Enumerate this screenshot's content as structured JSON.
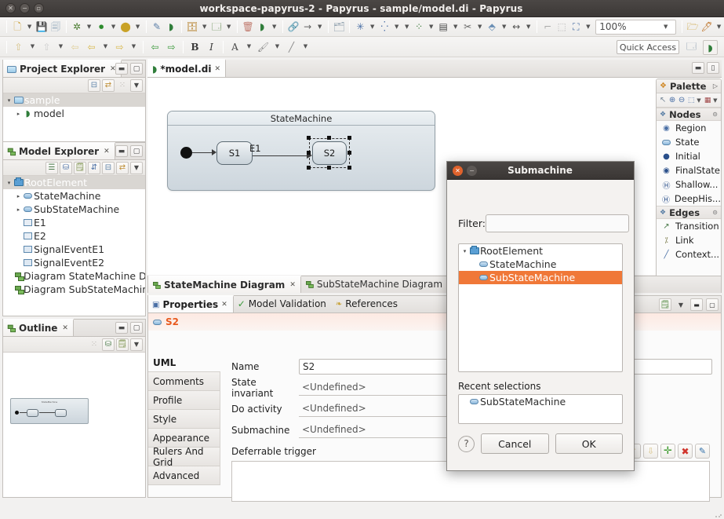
{
  "window": {
    "title": "workspace-papyrus-2 - Papyrus - sample/model.di - Papyrus",
    "controls": [
      "close",
      "minimize",
      "maximize"
    ]
  },
  "toolbar": {
    "row1": [
      {
        "name": "new-wizard",
        "glyph": "🗋",
        "menu": true
      },
      {
        "name": "save",
        "glyph": "💾"
      },
      {
        "name": "save-all",
        "glyph": "🗐"
      },
      {
        "name": "debug",
        "glyph": "🐞",
        "menu": true
      },
      {
        "name": "run",
        "glyph": "▶",
        "menu": true
      },
      {
        "name": "profile",
        "glyph": "🔍",
        "menu": true
      },
      {
        "name": "new-java-class",
        "glyph": "✎"
      },
      {
        "name": "papyrus-perspective",
        "glyph": "◗"
      },
      {
        "name": "import-model",
        "glyph": "📤",
        "menu": true
      },
      {
        "name": "new-diagram",
        "glyph": "🖼",
        "menu": true
      },
      {
        "name": "delete-element",
        "glyph": "🗑"
      },
      {
        "name": "papyrus-model",
        "glyph": "◗",
        "menu": true
      },
      {
        "name": "link-editor",
        "glyph": "🔗"
      },
      {
        "name": "forward-arrow",
        "glyph": "→",
        "menu": true
      },
      {
        "name": "open-resource",
        "glyph": "🗂"
      },
      {
        "name": "layout-grid",
        "glyph": "✳",
        "menu": true
      },
      {
        "name": "distribute",
        "glyph": "⫶",
        "menu": true
      },
      {
        "name": "align",
        "glyph": "⊞",
        "menu": true
      },
      {
        "name": "fill-color",
        "glyph": "▤",
        "menu": true
      },
      {
        "name": "line-style",
        "glyph": "✂",
        "menu": true
      },
      {
        "name": "flip",
        "glyph": "⬘",
        "menu": true
      },
      {
        "name": "size-width",
        "glyph": "↔",
        "menu": true
      },
      {
        "name": "snap-back",
        "glyph": "⌐"
      },
      {
        "name": "select-all",
        "glyph": "⬚"
      },
      {
        "name": "zoom-fit",
        "glyph": "⛶",
        "menu": true
      }
    ],
    "zoom_value": "100%",
    "row1_tail": [
      {
        "name": "open-perspective",
        "glyph": "🗁"
      },
      {
        "name": "pin-editor",
        "glyph": "🖊",
        "menu": true
      }
    ],
    "row2": [
      {
        "name": "arrow-up-small",
        "glyph": "⇧",
        "menu": true
      },
      {
        "name": "arrow-up-gray",
        "glyph": "⇧",
        "menu": true
      },
      {
        "name": "back-pale",
        "glyph": "⇦"
      },
      {
        "name": "back-yellow",
        "glyph": "⇦",
        "menu": true
      },
      {
        "name": "forward-yellow",
        "glyph": "⇨",
        "menu": true
      },
      {
        "name": "back-green",
        "glyph": "⇦"
      },
      {
        "name": "forward-green",
        "glyph": "⇨"
      },
      {
        "name": "bold",
        "glyph": "B"
      },
      {
        "name": "italic",
        "glyph": "I"
      },
      {
        "name": "font-color",
        "glyph": "A",
        "menu": true
      },
      {
        "name": "fill-color-2",
        "glyph": "🖌",
        "menu": true
      },
      {
        "name": "line-color",
        "glyph": "╱",
        "menu": true
      }
    ],
    "quick_access": "Quick Access",
    "perspective_buttons": [
      {
        "name": "open-perspective-icon",
        "glyph": "🗔"
      },
      {
        "name": "papyrus-perspective-icon",
        "glyph": "◗"
      }
    ]
  },
  "project_explorer": {
    "title": "Project Explorer",
    "view_buttons": [
      {
        "name": "collapse-all-icon",
        "glyph": "⊟"
      },
      {
        "name": "link-with-editor-icon",
        "glyph": "⇄"
      },
      {
        "name": "focus-icon",
        "glyph": "⁙"
      },
      {
        "name": "view-menu-icon",
        "glyph": "▾"
      }
    ],
    "items": [
      {
        "label": "sample",
        "icon": "project-folder-icon",
        "twisty": "▾",
        "indent": 0,
        "selected": true
      },
      {
        "label": "model",
        "icon": "papyrus-model-icon",
        "twisty": "▸",
        "indent": 1,
        "selected": false
      }
    ]
  },
  "model_explorer": {
    "title": "Model Explorer",
    "view_buttons": [
      {
        "name": "list-view-icon",
        "glyph": "☰"
      },
      {
        "name": "tree-view-icon",
        "glyph": "⛁"
      },
      {
        "name": "new-child-icon",
        "glyph": "🗒"
      },
      {
        "name": "sort-icon",
        "glyph": "⇅"
      },
      {
        "name": "collapse-all-icon",
        "glyph": "⊟"
      },
      {
        "name": "link-with-editor-icon",
        "glyph": "⇄"
      },
      {
        "name": "view-menu-icon",
        "glyph": "▾"
      }
    ],
    "items": [
      {
        "label": "RootElement",
        "icon": "package-icon",
        "twisty": "▾",
        "indent": 0,
        "selected": true
      },
      {
        "label": "StateMachine",
        "icon": "state-icon",
        "twisty": "▸",
        "indent": 1,
        "selected": false
      },
      {
        "label": "SubStateMachine",
        "icon": "state-icon",
        "twisty": "▸",
        "indent": 1,
        "selected": false
      },
      {
        "label": "E1",
        "icon": "signal-icon",
        "twisty": "",
        "indent": 1,
        "selected": false
      },
      {
        "label": "E2",
        "icon": "signal-icon",
        "twisty": "",
        "indent": 1,
        "selected": false
      },
      {
        "label": "SignalEventE1",
        "icon": "signal-event-icon",
        "twisty": "",
        "indent": 1,
        "selected": false
      },
      {
        "label": "SignalEventE2",
        "icon": "signal-event-icon",
        "twisty": "",
        "indent": 1,
        "selected": false
      },
      {
        "label": "Diagram StateMachine Diagr",
        "icon": "diagram-icon",
        "twisty": "",
        "indent": 1,
        "selected": false
      },
      {
        "label": "Diagram SubStateMachine D",
        "icon": "diagram-icon",
        "twisty": "",
        "indent": 1,
        "selected": false
      }
    ]
  },
  "outline": {
    "title": "Outline",
    "view_buttons": [
      {
        "name": "focus-icon",
        "glyph": "⁙"
      },
      {
        "name": "outline-tree-icon",
        "glyph": "⛁"
      },
      {
        "name": "outline-thumbnail-icon",
        "glyph": "🗒"
      },
      {
        "name": "view-menu-icon",
        "glyph": "▾"
      }
    ],
    "thumbnail_label": "StateMachine"
  },
  "editor": {
    "tab_label": "*model.di",
    "tab_icon": "papyrus-icon",
    "diagram": {
      "frame_title": "StateMachine",
      "nodes": [
        {
          "name": "initial-node",
          "label": ""
        },
        {
          "name": "state-s1",
          "label": "S1"
        },
        {
          "name": "state-s2",
          "label": "S2",
          "selected": true
        }
      ],
      "transition_label": "E1"
    },
    "min_max_buttons": [
      {
        "name": "minimize-editor-icon",
        "glyph": "▭"
      },
      {
        "name": "maximize-editor-icon",
        "glyph": "▢"
      }
    ]
  },
  "palette": {
    "title": "Palette",
    "expand_glyph": "▷",
    "tools": [
      {
        "name": "select-tool-icon",
        "glyph": "↖"
      },
      {
        "name": "zoom-in-tool-icon",
        "glyph": "⊕"
      },
      {
        "name": "zoom-out-tool-icon",
        "glyph": "⊖"
      },
      {
        "name": "marquee-tool-icon",
        "glyph": "⬚",
        "menu": true
      },
      {
        "name": "format-tool-icon",
        "glyph": "▦",
        "menu": true
      }
    ],
    "groups": [
      {
        "label": "Nodes",
        "items": [
          {
            "label": "Region",
            "icon": "region-icon"
          },
          {
            "label": "State",
            "icon": "state-icon"
          },
          {
            "label": "Initial",
            "icon": "initial-icon"
          },
          {
            "label": "FinalState",
            "icon": "final-state-icon"
          },
          {
            "label": "Shallow...",
            "icon": "shallow-history-icon"
          },
          {
            "label": "DeepHis...",
            "icon": "deep-history-icon"
          }
        ]
      },
      {
        "label": "Edges",
        "items": [
          {
            "label": "Transition",
            "icon": "transition-icon"
          },
          {
            "label": "Link",
            "icon": "link-icon"
          },
          {
            "label": "Context...",
            "icon": "context-link-icon"
          }
        ]
      }
    ]
  },
  "diagram_tabs": [
    {
      "label": "StateMachine Diagram",
      "active": true,
      "closable": true
    },
    {
      "label": "SubStateMachine Diagram",
      "active": false,
      "closable": false
    }
  ],
  "properties": {
    "tabs": [
      {
        "label": "Properties",
        "active": true,
        "icon": "properties-icon",
        "closable": true
      },
      {
        "label": "Model Validation",
        "active": false,
        "icon": "check-icon"
      },
      {
        "label": "References",
        "active": false,
        "icon": "references-icon"
      }
    ],
    "view_buttons": [
      {
        "name": "pin-properties-icon",
        "glyph": "🗒"
      },
      {
        "name": "view-menu-icon",
        "glyph": "▾"
      },
      {
        "name": "minimize-icon",
        "glyph": "▭"
      },
      {
        "name": "maximize-icon",
        "glyph": "▢"
      }
    ],
    "selected_element": "S2",
    "selected_element_icon": "state-icon",
    "left_tabs": [
      {
        "label": "UML",
        "active": true
      },
      {
        "label": "Comments",
        "active": false
      },
      {
        "label": "Profile",
        "active": false
      },
      {
        "label": "Style",
        "active": false
      },
      {
        "label": "Appearance",
        "active": false
      },
      {
        "label": "Rulers And Grid",
        "active": false
      },
      {
        "label": "Advanced",
        "active": false
      }
    ],
    "fields": [
      {
        "label": "Name",
        "value": "S2",
        "type": "text",
        "buttons": []
      },
      {
        "label": "State invariant",
        "value": "<Undefined>",
        "type": "ref",
        "buttons": [
          {
            "name": "browse-button",
            "glyph": "⋯"
          },
          {
            "name": "add-button",
            "glyph": "✛"
          },
          {
            "name": "edit-button",
            "glyph": "✎"
          },
          {
            "name": "delete-button",
            "glyph": "✖"
          }
        ]
      },
      {
        "label": "Do activity",
        "value": "<Undefined>",
        "type": "ref",
        "buttons": [
          {
            "name": "add-button",
            "glyph": "✛"
          },
          {
            "name": "edit-button",
            "glyph": "✎"
          },
          {
            "name": "delete-button",
            "glyph": "✖"
          }
        ]
      },
      {
        "label": "Submachine",
        "value": "<Undefined>",
        "type": "ref",
        "buttons": [
          {
            "name": "browse-button",
            "glyph": "⋯"
          },
          {
            "name": "add-button",
            "glyph": "✛"
          },
          {
            "name": "edit-button",
            "glyph": "✎"
          },
          {
            "name": "delete-button",
            "glyph": "✖"
          }
        ]
      }
    ],
    "deferrable_trigger": {
      "label": "Deferrable trigger",
      "value": "",
      "buttons": [
        {
          "name": "move-up-button",
          "glyph": "⇧"
        },
        {
          "name": "move-down-button",
          "glyph": "⇩"
        },
        {
          "name": "add-button",
          "glyph": "✛"
        },
        {
          "name": "delete-button",
          "glyph": "✖"
        },
        {
          "name": "edit-button",
          "glyph": "✎"
        }
      ]
    }
  },
  "dialog": {
    "title": "Submachine",
    "filter_label": "Filter:",
    "filter_value": "",
    "filter_placeholder": "",
    "tree": [
      {
        "label": "RootElement",
        "icon": "package-icon",
        "twisty": "▾",
        "indent": 0,
        "selected": false
      },
      {
        "label": "StateMachine",
        "icon": "state-icon",
        "twisty": "",
        "indent": 1,
        "selected": false
      },
      {
        "label": "SubStateMachine",
        "icon": "state-icon",
        "twisty": "",
        "indent": 1,
        "selected": true
      }
    ],
    "recent_label": "Recent selections",
    "recent_items": [
      {
        "label": "SubStateMachine",
        "icon": "state-icon"
      }
    ],
    "help_glyph": "?",
    "cancel_label": "Cancel",
    "ok_label": "OK"
  },
  "colors": {
    "selection_orange": "#f07838",
    "titlebar": "#3c3836",
    "panel_bg": "#f2f1f0",
    "accent_text": "#e8591e"
  }
}
